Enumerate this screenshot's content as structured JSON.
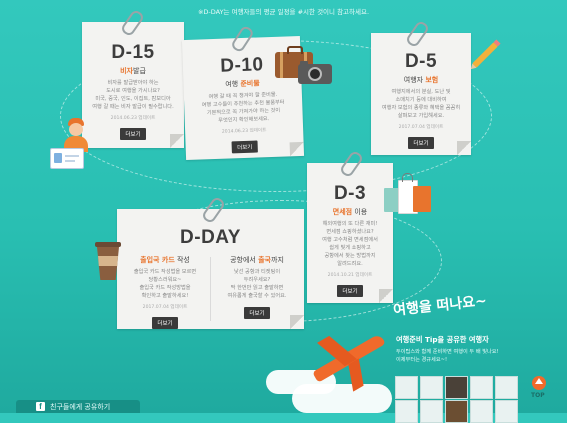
{
  "notice": "※D-DAY는 여행자들의 평균 일정을 #시한 것이니 참고하세요.",
  "cards": {
    "d15": {
      "day": "D-15",
      "subtitle_plain": "",
      "subtitle_hl": "비자",
      "subtitle_rest": "발급",
      "desc": "비자를 발급받아야 하는\n도시로 여행을 가시나요?\n미국, 중국, 인도, 이집트, 캄보디아\n여행 갈 때는 비자 발급이 필수랍니다.",
      "date": "2014.06.23 업데이트",
      "btn": "더보기"
    },
    "d10": {
      "day": "D-10",
      "subtitle_plain": "여행 ",
      "subtitle_hl": "준비물",
      "subtitle_rest": "",
      "desc": "여행 갈 때 꼭 챙겨야 할 준비물.\n여행 고수들이 추천하는 추천 물품부터\n기본적으로 꼭 가져가야 하는 것이\n무엇인지 확인해보세요.",
      "date": "2014.06.23 업데이트",
      "btn": "더보기"
    },
    "d5": {
      "day": "D-5",
      "subtitle_plain": "여행자 ",
      "subtitle_hl": "보험",
      "subtitle_rest": "",
      "desc": "여행지에서의 분실, 도난 및\n소매치기 등에 대비하여\n여행자 보험의 종류와 혜택을 꼼꼼히\n살펴보고 가입해세요.",
      "date": "2017.07.04 업데이트",
      "btn": "더보기"
    },
    "d3": {
      "day": "D-3",
      "subtitle_plain": "",
      "subtitle_hl": "면세점",
      "subtitle_rest": " 이용",
      "desc": "해외여행의 또 다른 재미!\n면세점 쇼핑하셨나요?\n여행 고수처럼 면세점에서\n쉽게 빛게 쇼핑하고\n공항에서 찾는 방법까지\n알려드려요.",
      "date": "2014.10.21 업데이트",
      "btn": "더보기"
    },
    "dday": {
      "day": "D-DAY",
      "left": {
        "subtitle_plain": "",
        "subtitle_hl": "출입국 카드",
        "subtitle_rest": " 작성",
        "desc": "출입국 카드 작성법을 모르면\n당황스러워요~\n출입국 카드 작성방법을\n확인하고 출발하세요!",
        "date": "2017.07.04 업데이트",
        "btn": "더보기"
      },
      "right": {
        "subtitle_plain": "공항에서 ",
        "subtitle_hl": "출국",
        "subtitle_rest": "까지",
        "desc": "낯선 공항과 티켓팅이\n두려우세요?\n딱 한번만 읽고 출발하면\n여유롭게 출국할 수 있어요.",
        "date": "",
        "btn": "더보기"
      }
    }
  },
  "sns": {
    "title": "여행을 떠나요~",
    "subtitle": "여행준비 Tip을 공유한 여행자",
    "desc": "두이팁스와 함께 준비하면 여행이 두 배 빛나요!\n이제부터는 경규세요~!",
    "facebook_label": "친구들에게 공유하기",
    "top_label": "TOP"
  },
  "colors": {
    "accent": "#e8742d",
    "teal": "#2fc4b8",
    "button": "#3a3a3a"
  }
}
